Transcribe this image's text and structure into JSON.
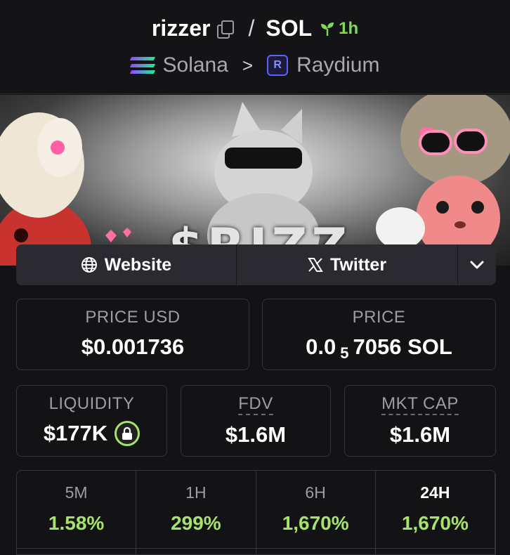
{
  "header": {
    "token_symbol": "rizzer",
    "separator": "/",
    "quote_symbol": "SOL",
    "pair_age": "1h",
    "chain": "Solana",
    "breadcrumb_sep": ">",
    "dex": "Raydium",
    "age_color": "#7ed957"
  },
  "banner": {
    "text": "$RIZZ"
  },
  "links": {
    "website_label": "Website",
    "twitter_label": "Twitter"
  },
  "prices": {
    "price_usd_label": "PRICE USD",
    "price_usd_value": "$0.001736",
    "price_label": "PRICE",
    "price_prefix": "0.0",
    "price_zeros": "5",
    "price_suffix": "7056 SOL"
  },
  "stats": {
    "liquidity_label": "LIQUIDITY",
    "liquidity_value": "$177K",
    "fdv_label": "FDV",
    "fdv_value": "$1.6M",
    "mktcap_label": "MKT CAP",
    "mktcap_value": "$1.6M"
  },
  "changes": [
    {
      "period": "5M",
      "value": "1.58%"
    },
    {
      "period": "1H",
      "value": "299%"
    },
    {
      "period": "6H",
      "value": "1,670%"
    },
    {
      "period": "24H",
      "value": "1,670%"
    }
  ],
  "colors": {
    "positive": "#a6e36a",
    "background": "#131316",
    "card_border": "#34343b"
  }
}
